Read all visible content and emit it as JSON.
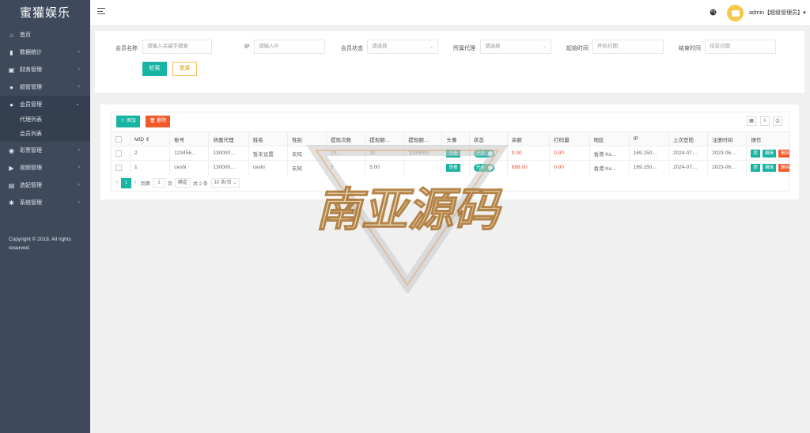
{
  "app": {
    "title": "蜜獾娱乐"
  },
  "sidebar": {
    "items": [
      {
        "label": "首页",
        "icon": "home-icon",
        "glyph": "⌂",
        "arrow": ""
      },
      {
        "label": "数据统计",
        "icon": "bar-chart-icon",
        "glyph": "▮",
        "arrow": "›"
      },
      {
        "label": "财务管理",
        "icon": "finance-icon",
        "glyph": "▣",
        "arrow": "›"
      },
      {
        "label": "超管管理",
        "icon": "user-icon",
        "glyph": "●",
        "arrow": "›"
      },
      {
        "label": "会员管理",
        "icon": "users-icon",
        "glyph": "●",
        "arrow": "⌄"
      }
    ],
    "subitems": [
      {
        "label": "代理列表"
      },
      {
        "label": "会员列表"
      }
    ],
    "items_after": [
      {
        "label": "彩票管理",
        "icon": "gamepad-icon",
        "glyph": "◉",
        "arrow": "›"
      },
      {
        "label": "视频管理",
        "icon": "video-icon",
        "glyph": "▶",
        "arrow": "›"
      },
      {
        "label": "选妃管理",
        "icon": "card-icon",
        "glyph": "▤",
        "arrow": "›"
      },
      {
        "label": "系统管理",
        "icon": "gear-icon",
        "glyph": "✱",
        "arrow": "›"
      }
    ],
    "copyright": "Copyright © 2019. All rights reserved."
  },
  "header": {
    "user": "admin【超级管理员】▾"
  },
  "search": {
    "member_name_label": "会员名称",
    "member_name_placeholder": "请输入关键字搜索",
    "ip_label": "IP",
    "ip_placeholder": "请输入IP",
    "status_label": "会员状态",
    "status_value": "请选择",
    "agent_label": "所属代理",
    "agent_value": "请选择",
    "start_label": "起始时间",
    "start_placeholder": "开始日期",
    "end_label": "结束时间",
    "end_placeholder": "结束日期",
    "search_button": "检索",
    "reset_button": "重置"
  },
  "toolbar": {
    "add": "＋ 添加",
    "delete": "🗑 删除"
  },
  "table": {
    "columns": [
      "MID ⇕",
      "账号",
      "所属代理",
      "姓名",
      "性别",
      "提现次数",
      "提现额…",
      "提现额…",
      "头像",
      "状态",
      "余额",
      "打码量",
      "地区",
      "IP",
      "上次登陆",
      "注册时间",
      "操作"
    ],
    "rows": [
      {
        "mid": "2",
        "account": "123456…",
        "agent": "130000…",
        "name": "暂未设置",
        "gender": "未知",
        "withdraw_count": "10…",
        "withdraw_a": "10",
        "withdraw_b": "1000000",
        "avatar": "查看",
        "status": "开启",
        "balance": "0.00",
        "code": "0.00",
        "region": "香港 Ko…",
        "ip": "169.150…",
        "last_login": "2024-07…",
        "register": "2023-06…",
        "op1": "提",
        "op2": "编辑",
        "op3": "删除"
      },
      {
        "mid": "1",
        "account": "ceshi",
        "agent": "130000…",
        "name": "ceshi",
        "gender": "未知",
        "withdraw_count": "5",
        "withdraw_a": "5.00",
        "withdraw_b": "",
        "avatar": "查看",
        "status": "开启",
        "balance": "898.00",
        "code": "0.00",
        "region": "香港 Ko…",
        "ip": "169.150…",
        "last_login": "2024-07…",
        "register": "2023-06…",
        "op1": "提",
        "op2": "编辑",
        "op3": "删除"
      }
    ]
  },
  "pager": {
    "current": "1",
    "goto_label": "到第",
    "page_input": "1",
    "page_suffix": "页",
    "confirm": "确定",
    "total": "共 2 条",
    "per_page": "10 条/页 ⌄"
  },
  "watermark": {
    "text": "南亚源码"
  }
}
